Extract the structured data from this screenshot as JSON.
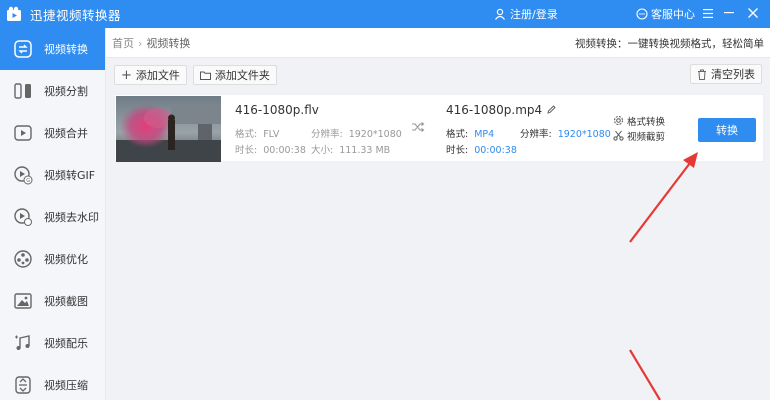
{
  "titlebar": {
    "app_title": "迅捷视频转换器",
    "user_label": "注册/登录",
    "support_label": "客服中心"
  },
  "sidebar": {
    "items": [
      {
        "label": "视频转换",
        "icon": "video-convert-icon",
        "active": true
      },
      {
        "label": "视频分割",
        "icon": "video-split-icon"
      },
      {
        "label": "视频合并",
        "icon": "video-merge-icon"
      },
      {
        "label": "视频转GIF",
        "icon": "video-gif-icon"
      },
      {
        "label": "视频去水印",
        "icon": "video-watermark-icon"
      },
      {
        "label": "视频优化",
        "icon": "video-optimize-icon"
      },
      {
        "label": "视频截图",
        "icon": "video-screenshot-icon"
      },
      {
        "label": "视频配乐",
        "icon": "video-music-icon"
      },
      {
        "label": "视频压缩",
        "icon": "video-compress-icon"
      }
    ]
  },
  "breadcrumb": {
    "home": "首页",
    "current": "视频转换"
  },
  "tip": "视频转换：一键转换视频格式，轻松简单",
  "toolbar": {
    "add_file": "添加文件",
    "add_folder": "添加文件夹",
    "clear_list": "清空列表"
  },
  "file": {
    "src_name": "416-1080p.flv",
    "src_format_label": "格式:",
    "src_format": "FLV",
    "src_res_label": "分辨率:",
    "src_res": "1920*1080",
    "src_dur_label": "时长:",
    "src_dur": "00:00:38",
    "src_size_label": "大小:",
    "src_size": "111.33 MB",
    "dst_name": "416-1080p.mp4",
    "dst_format_label": "格式:",
    "dst_format": "MP4",
    "dst_res_label": "分辨率:",
    "dst_res": "1920*1080",
    "dst_dur_label": "时长:",
    "dst_dur": "00:00:38",
    "format_settings": "格式转换",
    "video_trim": "视频截剪",
    "convert_button": "转换"
  },
  "colors": {
    "brand_blue": "#2f8cf0",
    "annotation_red": "#e53935"
  }
}
